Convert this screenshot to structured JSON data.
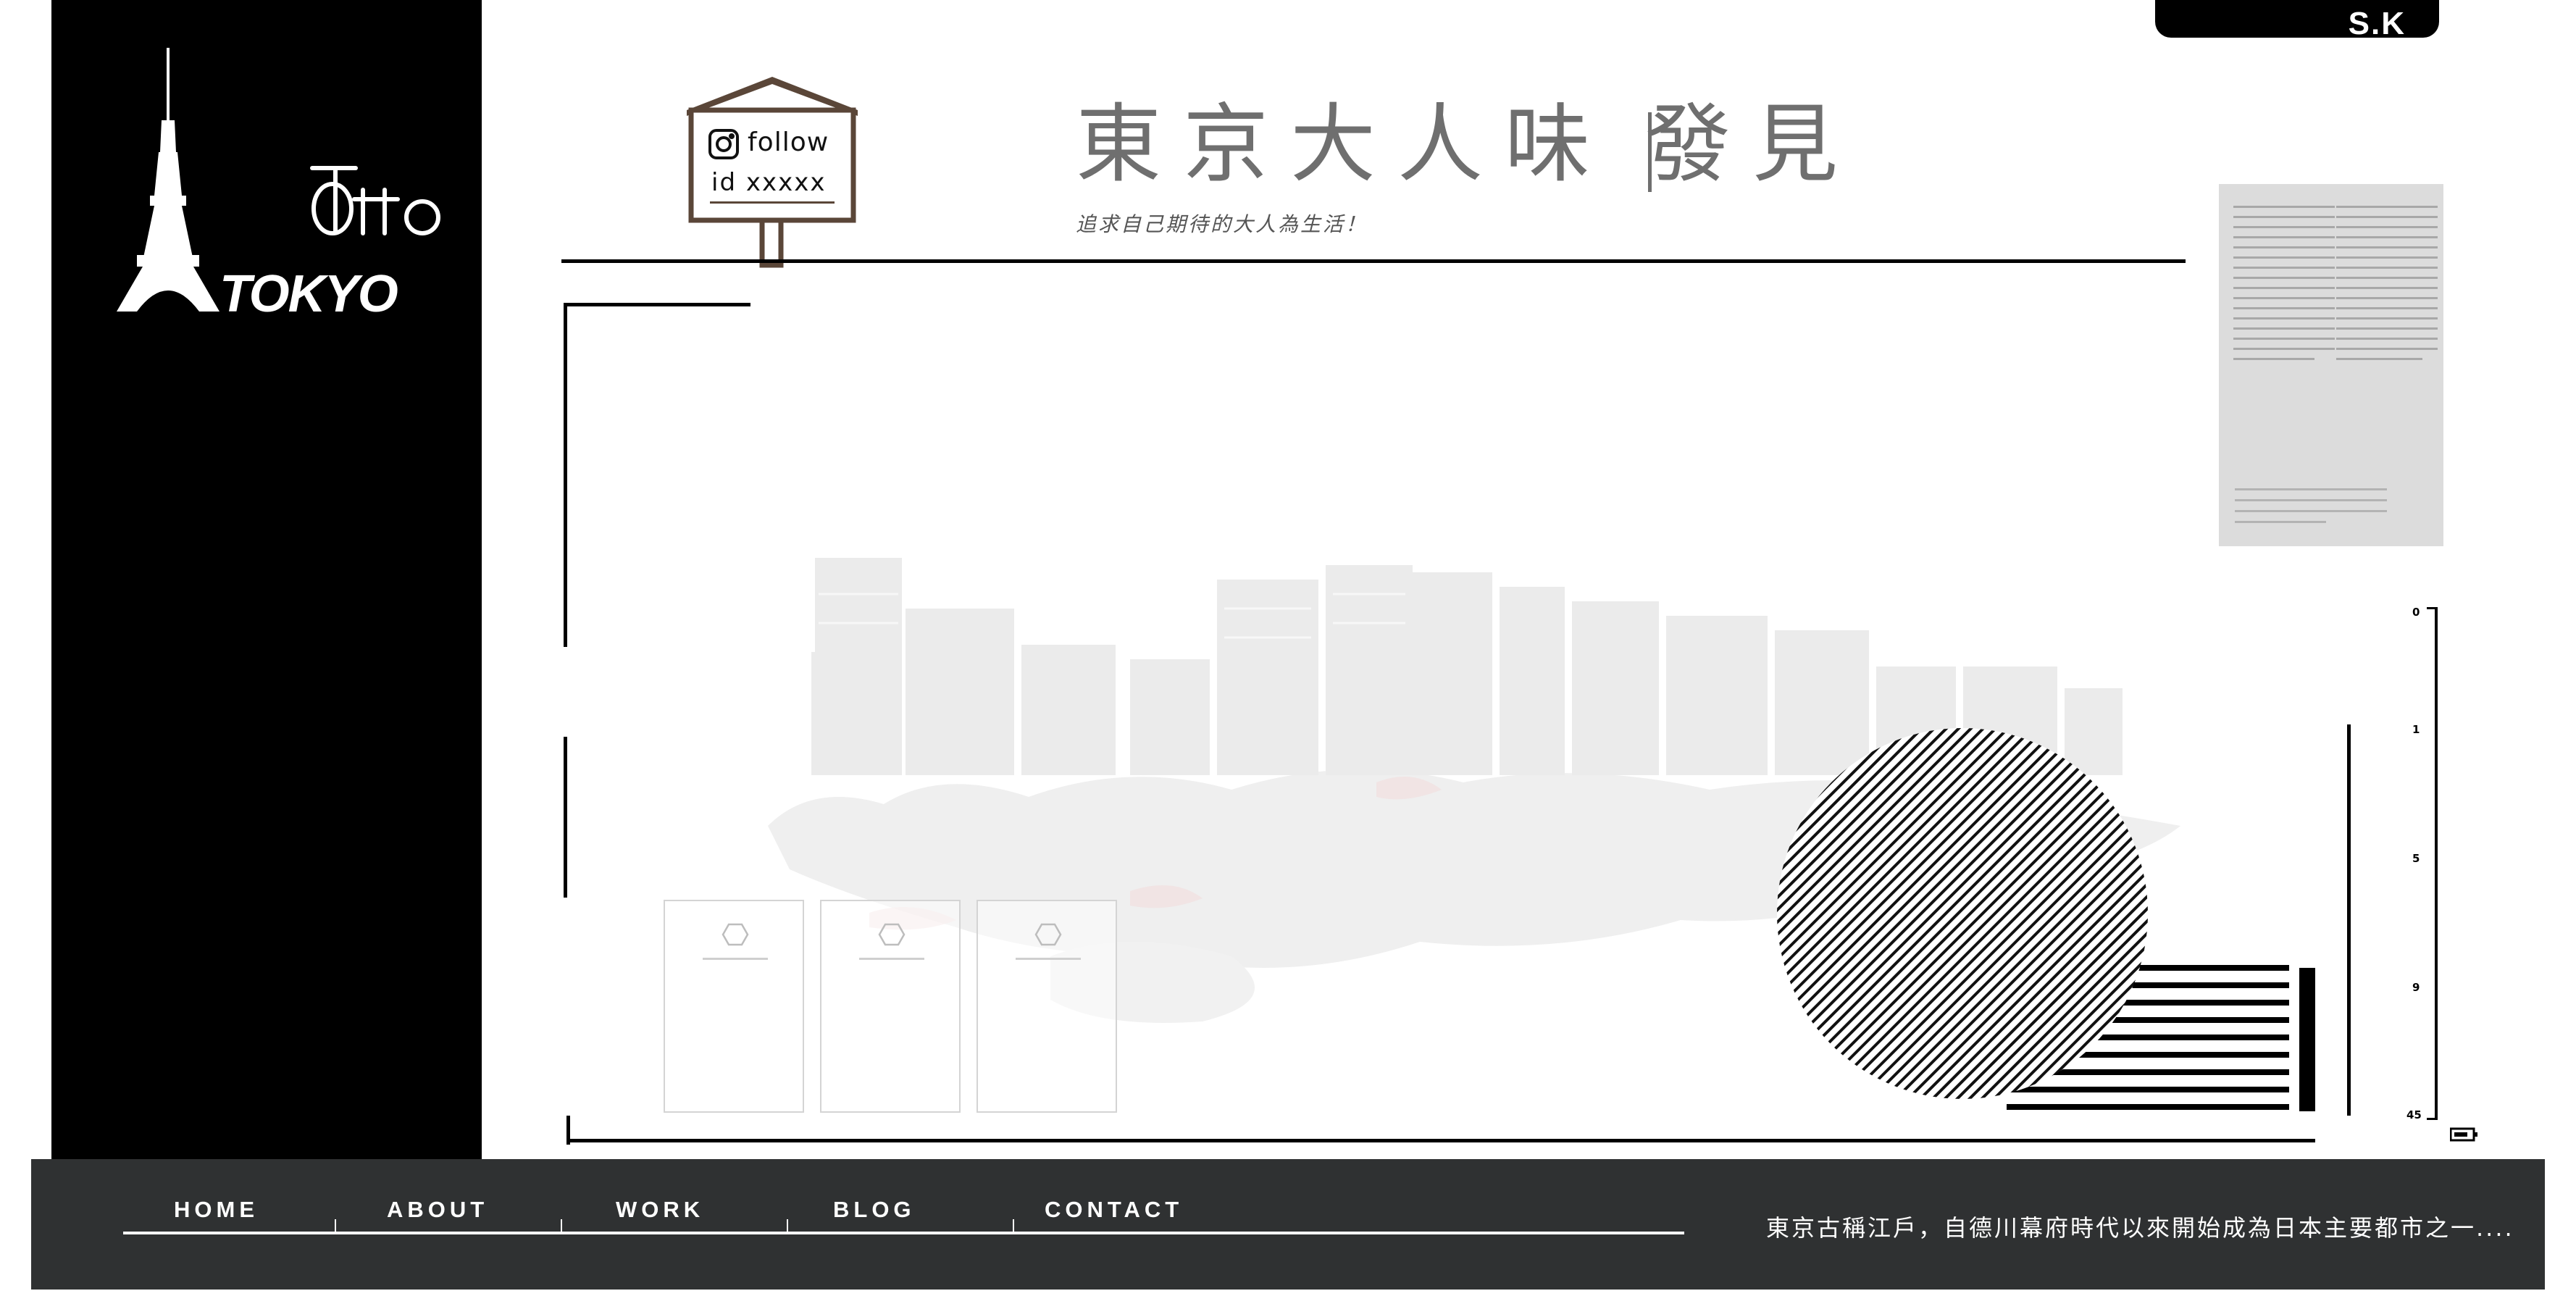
{
  "brand": {
    "logo_text": "Otto TOKYO"
  },
  "corner_tab": {
    "label": "S.K"
  },
  "follow_sign": {
    "label": "follow",
    "id_text": "id xxxxx"
  },
  "header": {
    "title": "東京大人味",
    "title_part2": "發見",
    "subtitle": "追求自己期待的大人為生活！"
  },
  "scale": {
    "ticks": [
      "0",
      "1",
      "5",
      "9",
      "45"
    ]
  },
  "nav": {
    "items": [
      "HOME",
      "ABOUT",
      "WORK",
      "BLOG",
      "CONTACT"
    ]
  },
  "footer": {
    "text": "東京古稱江戶，自德川幕府時代以來開始成為日本主要都市之一...."
  },
  "colors": {
    "sidebar": "#000000",
    "bottom_bar": "#2f3132",
    "title": "#6f6f6f",
    "article_block": "#dcdcdc",
    "sign_brown": "#5a4638"
  }
}
